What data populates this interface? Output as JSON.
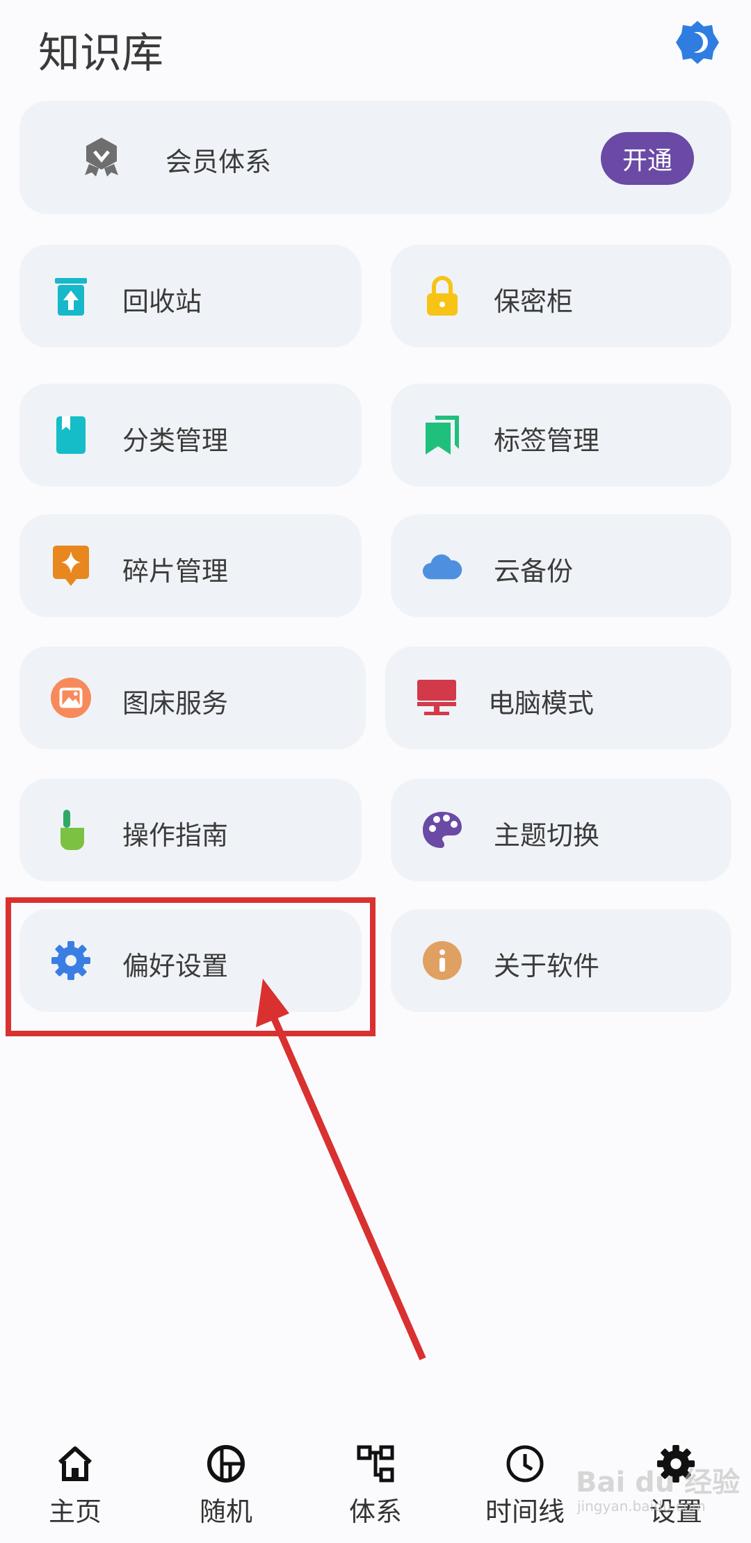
{
  "header": {
    "title": "知识库",
    "theme_icon": "theme-toggle-icon"
  },
  "member": {
    "label": "会员体系",
    "button": "开通",
    "icon": "medal-icon"
  },
  "grid": [
    {
      "name": "recycle-bin",
      "label": "回收站",
      "icon": "trash-restore-icon",
      "color": "#16b8c9"
    },
    {
      "name": "vault",
      "label": "保密柜",
      "icon": "lock-icon",
      "color": "#f7c315"
    },
    {
      "name": "category-manage",
      "label": "分类管理",
      "icon": "book-icon",
      "color": "#14bdc8"
    },
    {
      "name": "tag-manage",
      "label": "标签管理",
      "icon": "bookmarks-icon",
      "color": "#1fbf7c"
    },
    {
      "name": "fragment-manage",
      "label": "碎片管理",
      "icon": "sparkle-note-icon",
      "color": "#e8871e"
    },
    {
      "name": "cloud-backup",
      "label": "云备份",
      "icon": "cloud-icon",
      "color": "#4e8fe0"
    },
    {
      "name": "image-host",
      "label": "图床服务",
      "icon": "image-icon",
      "color": "#f78a5b"
    },
    {
      "name": "desktop-mode",
      "label": "电脑模式",
      "icon": "monitor-icon",
      "color": "#d23a4a"
    },
    {
      "name": "guide",
      "label": "操作指南",
      "icon": "hand-pointer-icon",
      "color": "#7cc142"
    },
    {
      "name": "theme-switch",
      "label": "主题切换",
      "icon": "palette-icon",
      "color": "#6a4aa5"
    },
    {
      "name": "preferences",
      "label": "偏好设置",
      "icon": "gear-icon",
      "color": "#3b7ee3"
    },
    {
      "name": "about",
      "label": "关于软件",
      "icon": "info-icon",
      "color": "#e0a062"
    }
  ],
  "tabs": [
    {
      "label": "主页",
      "icon": "home-icon"
    },
    {
      "label": "随机",
      "icon": "random-icon"
    },
    {
      "label": "体系",
      "icon": "hierarchy-icon"
    },
    {
      "label": "时间线",
      "icon": "clock-icon"
    },
    {
      "label": "设置",
      "icon": "gear-icon"
    }
  ],
  "watermark": {
    "text": "Bai du 经验",
    "sub": "jingyan.baidu.com"
  }
}
